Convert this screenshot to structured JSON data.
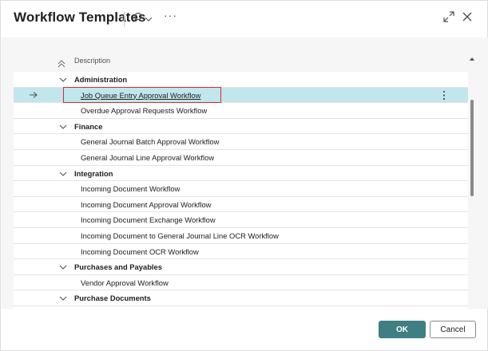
{
  "header": {
    "title": "Workflow Templates",
    "more_label": "···"
  },
  "list": {
    "column_header": "Description",
    "rows": [
      {
        "type": "group",
        "label": "Administration"
      },
      {
        "type": "item",
        "label": "Job Queue Entry Approval Workflow",
        "selected": true
      },
      {
        "type": "item",
        "label": "Overdue Approval Requests Workflow"
      },
      {
        "type": "group",
        "label": "Finance"
      },
      {
        "type": "item",
        "label": "General Journal Batch Approval Workflow"
      },
      {
        "type": "item",
        "label": "General Journal Line Approval Workflow"
      },
      {
        "type": "group",
        "label": "Integration"
      },
      {
        "type": "item",
        "label": "Incoming Document Workflow"
      },
      {
        "type": "item",
        "label": "Incoming Document Approval Workflow"
      },
      {
        "type": "item",
        "label": "Incoming Document Exchange Workflow"
      },
      {
        "type": "item",
        "label": "Incoming Document to General Journal Line OCR Workflow"
      },
      {
        "type": "item",
        "label": "Incoming Document OCR Workflow"
      },
      {
        "type": "group",
        "label": "Purchases and Payables"
      },
      {
        "type": "item",
        "label": "Vendor Approval Workflow"
      },
      {
        "type": "group",
        "label": "Purchase Documents"
      }
    ]
  },
  "footer": {
    "ok_label": "OK",
    "cancel_label": "Cancel"
  },
  "colors": {
    "accent": "#3f7f83",
    "selected_row": "#c1e6ec",
    "highlight_border": "#d92b2b"
  },
  "icons": [
    "search-icon",
    "chevron-down-icon",
    "more-icon",
    "expand-icon",
    "close-icon",
    "sort-icon",
    "row-arrow-icon",
    "kebab-icon"
  ]
}
